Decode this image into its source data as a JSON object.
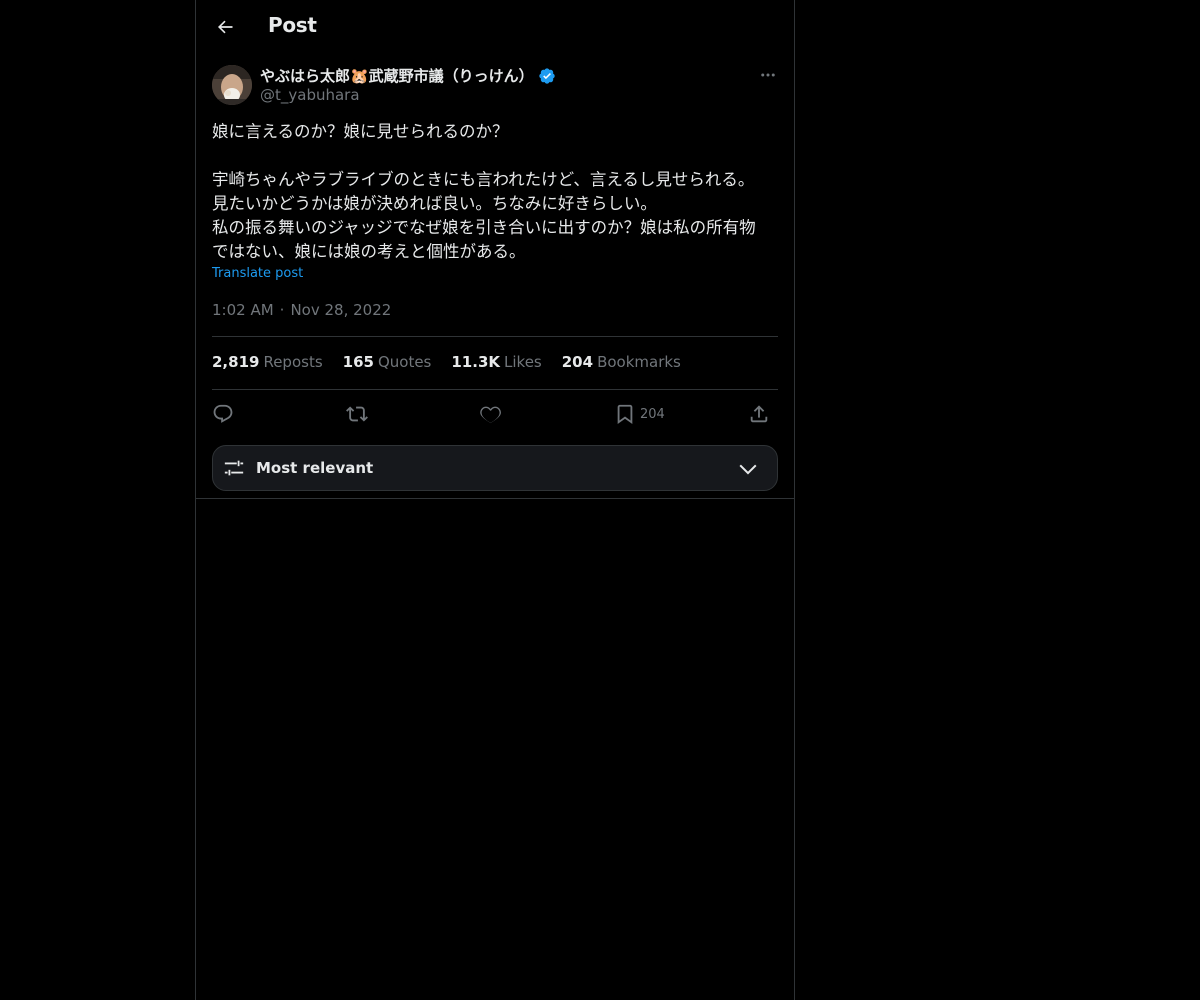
{
  "header": {
    "back_icon": "arrow-left-icon",
    "title": "Post"
  },
  "author": {
    "name": "やぶはら太郎🐹武蔵野市議（りっけん）",
    "handle": "@t_yabuhara",
    "verified": true,
    "verified_color": "#1d9bf0"
  },
  "post": {
    "lines": [
      "娘に言えるのか？娘に見せられるのか？",
      "",
      "宇崎ちゃんやラブライブのときにも言われたけど、言えるし見せられる。",
      "見たいかどうかは娘が決めれば良い。ちなみに好きらしい。",
      "私の振る舞いのジャッジでなぜ娘を引き合いに出すのか？娘は私の所有物",
      "ではない、娘には娘の考えと個性がある。"
    ],
    "translate_label": "Translate post",
    "time": "1:02 AM",
    "separator": "·",
    "date": "Nov 28, 2022"
  },
  "stats": {
    "reposts": {
      "num": "2,819",
      "label": "Reposts"
    },
    "quotes": {
      "num": "165",
      "label": "Quotes"
    },
    "likes": {
      "num": "11.3K",
      "label": "Likes"
    },
    "bookmarks": {
      "num": "204",
      "label": "Bookmarks"
    }
  },
  "actions": {
    "reply_icon": "reply-icon",
    "repost_icon": "repost-icon",
    "like_icon": "heart-icon",
    "bookmark_icon": "bookmark-icon",
    "bookmark_count": "204",
    "share_icon": "share-icon"
  },
  "replies_filter": {
    "label": "Most relevant",
    "icon": "sliders-icon",
    "chevron": "chevron-down-icon"
  },
  "colors": {
    "background": "#000000",
    "text": "#e7e9ea",
    "muted": "#71767b",
    "accent": "#1d9bf0",
    "border": "#2f3336"
  }
}
